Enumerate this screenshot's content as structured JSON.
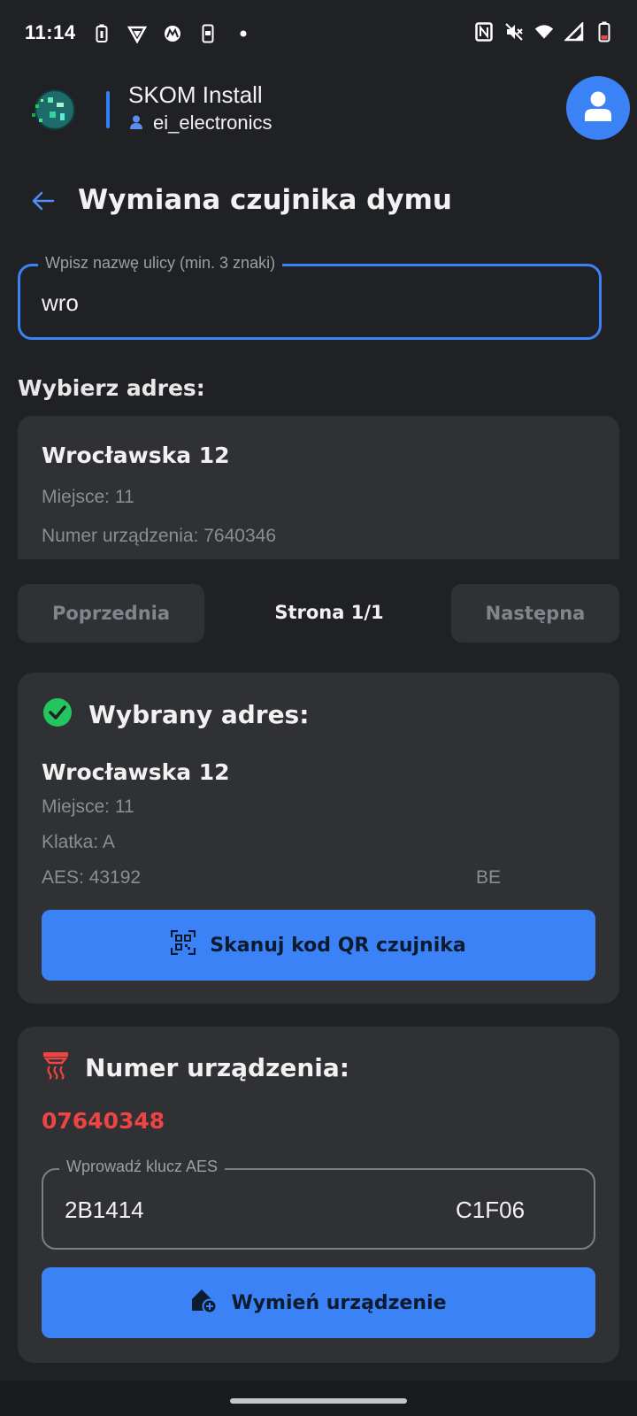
{
  "status_bar": {
    "time": "11:14",
    "left_icons": [
      "battery-saver-icon",
      "vpn-shield-icon",
      "motorola-icon",
      "phone-storage-icon",
      "dot-icon"
    ],
    "right_icons": [
      "nfc-icon",
      "mute-icon",
      "wifi-icon",
      "signal-icon",
      "battery-low-icon"
    ]
  },
  "header": {
    "app_name": "SKOM Install",
    "username": "ei_electronics",
    "accent_color": "#3b82f6"
  },
  "page": {
    "title": "Wymiana czujnika dymu"
  },
  "street_search": {
    "label": "Wpisz nazwę ulicy (min. 3 znaki)",
    "value": "wro"
  },
  "address_list": {
    "label": "Wybierz adres:",
    "items": [
      {
        "street": "Wrocławska 12",
        "place": "Miejsce: 11",
        "device_number": "Numer urządzenia: 7640346"
      }
    ]
  },
  "pagination": {
    "prev_label": "Poprzednia",
    "page_indicator": "Strona 1/1",
    "next_label": "Następna"
  },
  "selected_address": {
    "heading": "Wybrany adres:",
    "street": "Wrocławska 12",
    "place": "Miejsce: 11",
    "staircase": "Klatka: A",
    "aes": "AES: 43192",
    "aes_suffix": "BE",
    "scan_button_label": "Skanuj kod QR czujnika"
  },
  "device": {
    "heading": "Numer urządzenia:",
    "number": "07640348",
    "number_color": "#ef4444",
    "aes_field": {
      "label": "Wprowadź klucz AES",
      "value_part1": "2B1414",
      "value_part2": "C1F06"
    },
    "replace_button_label": "Wymień urządzenie"
  }
}
